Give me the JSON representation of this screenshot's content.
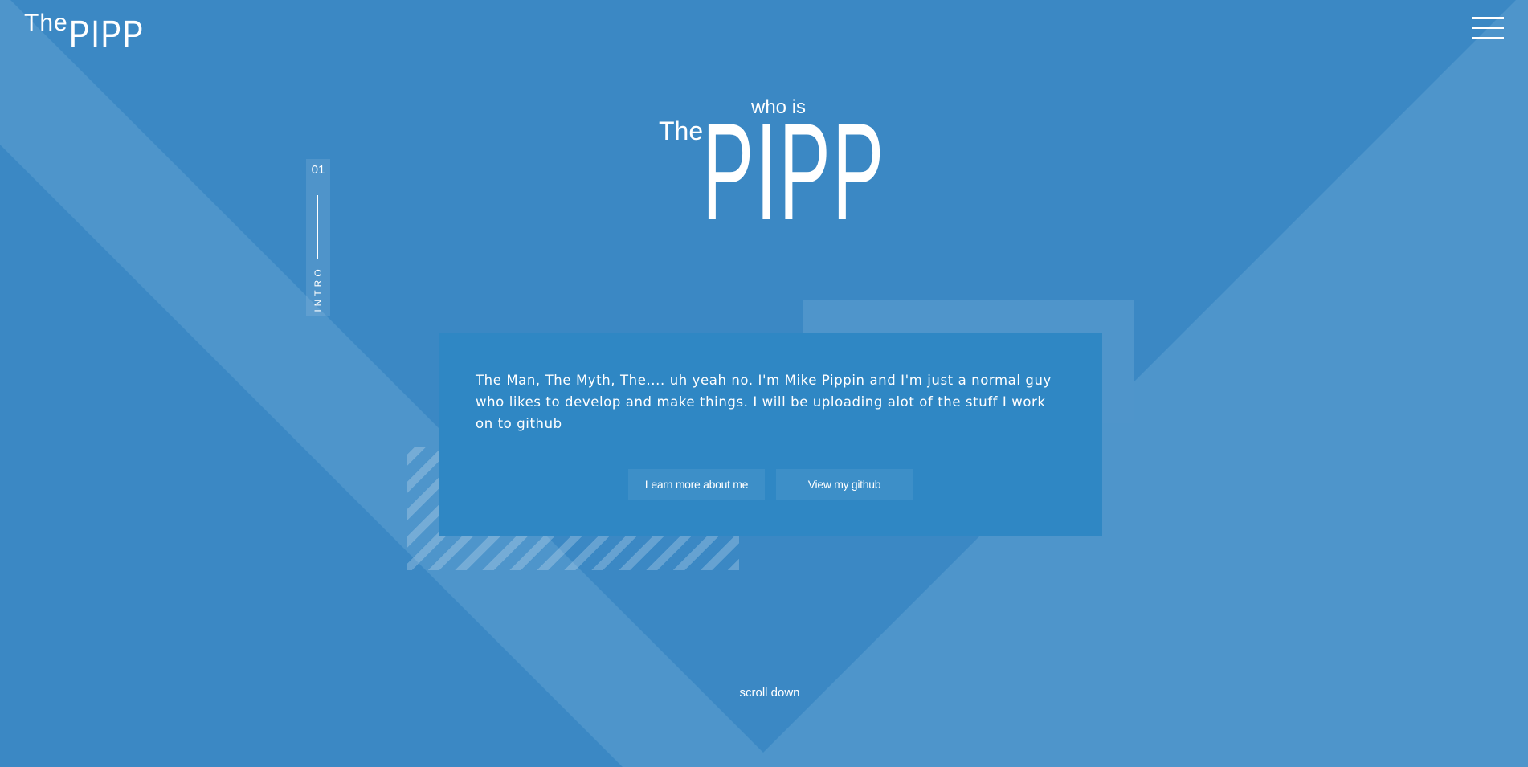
{
  "colors": {
    "background": "#3b88c4",
    "band": "#4e95cb",
    "card": "#2f87c4",
    "text": "#ffffff"
  },
  "header": {
    "logo": {
      "the": "The",
      "pipp": "PIPP"
    },
    "menu_icon": "hamburger-menu-icon"
  },
  "hero": {
    "who_is": "who is",
    "the": "The",
    "pipp": "PIPP"
  },
  "section_indicator": {
    "number": "01",
    "label": "INTRO"
  },
  "card": {
    "text": "The Man, The Myth, The.... uh yeah no. I'm Mike Pippin and I'm just a normal guy who likes to develop and make things. I will be uploading alot of the stuff I work on to github",
    "buttons": [
      {
        "label": "Learn more about me"
      },
      {
        "label": "View my github"
      }
    ]
  },
  "scroll": {
    "label": "scroll down"
  }
}
